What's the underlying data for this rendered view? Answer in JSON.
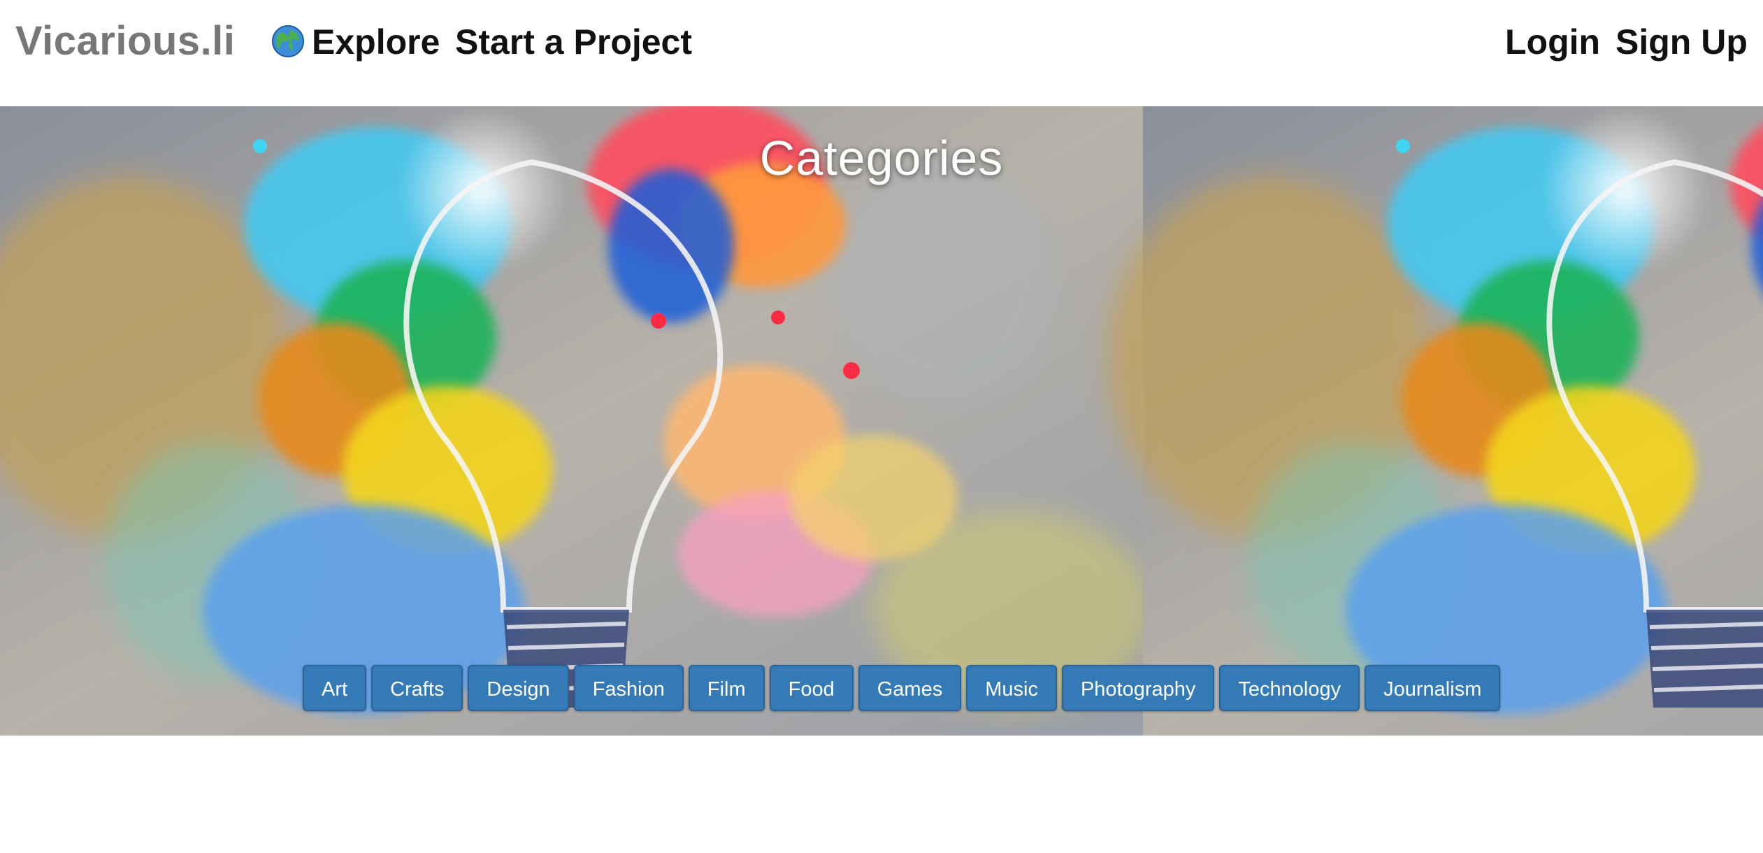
{
  "nav": {
    "brand": "Vicarious.li",
    "explore": "Explore",
    "start_project": "Start a Project",
    "login": "Login",
    "signup": "Sign Up"
  },
  "hero": {
    "title": "Categories",
    "background": "painted-lightbulb-image"
  },
  "categories": [
    "Art",
    "Crafts",
    "Design",
    "Fashion",
    "Film",
    "Food",
    "Games",
    "Music",
    "Photography",
    "Technology",
    "Journalism"
  ],
  "colors": {
    "button_primary": "#337ab7",
    "brand_gray": "#777777"
  }
}
